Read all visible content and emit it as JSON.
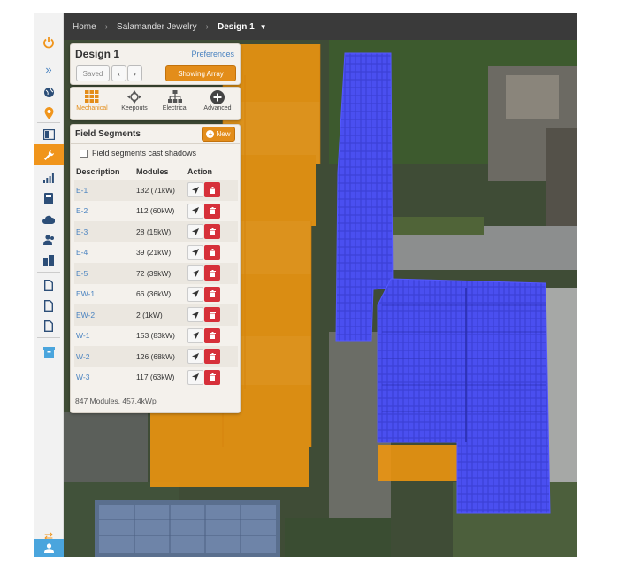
{
  "breadcrumb": {
    "home": "Home",
    "project": "Salamander Jewelry",
    "current": "Design 1"
  },
  "design": {
    "title": "Design 1",
    "preferences": "Preferences",
    "saved": "Saved",
    "showing_array": "Showing Array"
  },
  "tools": [
    {
      "label": "Mechanical",
      "icon": "grid-icon"
    },
    {
      "label": "Keepouts",
      "icon": "keepouts-icon"
    },
    {
      "label": "Electrical",
      "icon": "electrical-icon"
    },
    {
      "label": "Advanced",
      "icon": "plus-circle-icon"
    }
  ],
  "fields": {
    "title": "Field Segments",
    "new_label": "New",
    "shadow_label": "Field segments cast shadows",
    "columns": [
      "Description",
      "Modules",
      "Action"
    ],
    "rows": [
      {
        "desc": "E-1",
        "modules": "132 (71kW)"
      },
      {
        "desc": "E-2",
        "modules": "112 (60kW)"
      },
      {
        "desc": "E-3",
        "modules": "28 (15kW)"
      },
      {
        "desc": "E-4",
        "modules": "39 (21kW)"
      },
      {
        "desc": "E-5",
        "modules": "72 (39kW)"
      },
      {
        "desc": "EW-1",
        "modules": "66 (36kW)"
      },
      {
        "desc": "EW-2",
        "modules": "2 (1kW)"
      },
      {
        "desc": "W-1",
        "modules": "153 (83kW)"
      },
      {
        "desc": "W-2",
        "modules": "126 (68kW)"
      },
      {
        "desc": "W-3",
        "modules": "117 (63kW)"
      }
    ],
    "footer": "847 Modules, 457.4kWp"
  },
  "colors": {
    "accent": "#e38d1a",
    "panel_blue": "#3b3fd6",
    "keepout": "#f0960f",
    "topbar": "#3a3a3a"
  }
}
